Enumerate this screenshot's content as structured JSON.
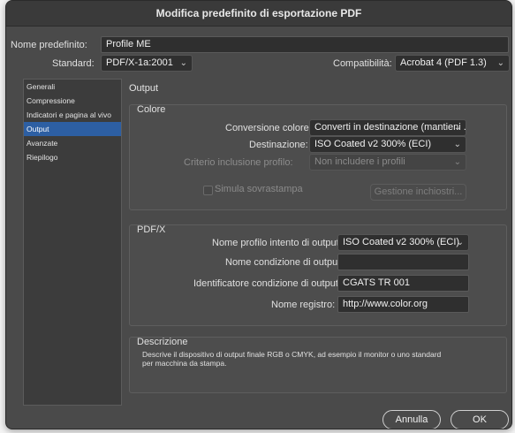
{
  "window": {
    "title": "Modifica predefinito di esportazione PDF"
  },
  "preset": {
    "label": "Nome predefinito:",
    "value": "Profile ME"
  },
  "standard": {
    "label": "Standard:",
    "value": "PDF/X-1a:2001"
  },
  "compat": {
    "label": "Compatibilità:",
    "value": "Acrobat 4 (PDF 1.3)"
  },
  "sidebar": {
    "items": [
      {
        "label": "Generali"
      },
      {
        "label": "Compressione"
      },
      {
        "label": "Indicatori e pagina al vivo"
      },
      {
        "label": "Output"
      },
      {
        "label": "Avanzate"
      },
      {
        "label": "Riepilogo"
      }
    ]
  },
  "main": {
    "title": "Output"
  },
  "colore": {
    "title": "Colore",
    "conversion_label": "Conversione colore:",
    "conversion_value": "Converti in destinazione (mantieni ...",
    "destination_label": "Destinazione:",
    "destination_value": "ISO Coated v2 300% (ECI)",
    "profile_label": "Criterio inclusione profilo:",
    "profile_value": "Non includere i profili",
    "simulate_label": "Simula sovrastampa",
    "ink_button": "Gestione inchiostri..."
  },
  "pdfx": {
    "title": "PDF/X",
    "intent_label": "Nome profilo intento di output:",
    "intent_value": "ISO Coated v2 300% (ECI)",
    "condition_name_label": "Nome condizione di output:",
    "condition_name_value": "",
    "condition_id_label": "Identificatore condizione di output:",
    "condition_id_value": "CGATS TR 001",
    "registry_label": "Nome registro:",
    "registry_value": "http://www.color.org"
  },
  "description": {
    "title": "Descrizione",
    "line1": "Descrive il dispositivo di output finale RGB o CMYK, ad esempio il monitor o uno standard",
    "line2": "per macchina da stampa."
  },
  "buttons": {
    "cancel": "Annulla",
    "ok": "OK"
  }
}
